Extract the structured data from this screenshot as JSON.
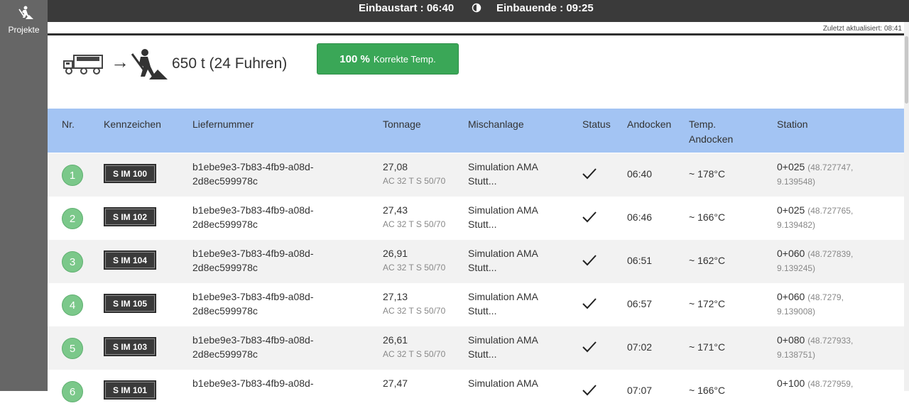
{
  "sidebar": {
    "items": [
      {
        "label": "Projekte",
        "icon": "road-worker-icon"
      }
    ]
  },
  "topbar": {
    "start": "Einbaustart : 06:40",
    "end": "Einbauende : 09:25"
  },
  "updated": "Zuletzt aktualisiert: 08:41",
  "summary": {
    "tonnage": "650 t (24 Fuhren)",
    "pct": "100 %",
    "label": "Korrekte Temp."
  },
  "colors": {
    "accent_green": "#3aa757",
    "header_blue": "#a3c4f3",
    "plate_bg": "#3a3a3a",
    "topbar_bg": "#3a3a3a",
    "sidebar_bg": "#666666"
  },
  "table": {
    "headers": [
      "Nr.",
      "Kennzeichen",
      "Liefernummer",
      "Tonnage",
      "Mischanlage",
      "Status",
      "Andocken",
      "Temp.",
      "Andocken",
      "Station"
    ],
    "rows": [
      {
        "nr": "1",
        "plate": "S IM 100",
        "lief1": "b1ebe9e3-7b83-4fb9-a08d-",
        "lief2": "2d8ec599978c",
        "ton": "27,08",
        "mix": "AC 32 T S 50/70",
        "plant1": "Simulation AMA",
        "plant2": "Stutt...",
        "dock": "06:40",
        "temp": "~ 178°C",
        "station": "0+025",
        "coord1": "(48.727747,",
        "coord2": "9.139548)"
      },
      {
        "nr": "2",
        "plate": "S IM 102",
        "lief1": "b1ebe9e3-7b83-4fb9-a08d-",
        "lief2": "2d8ec599978c",
        "ton": "27,43",
        "mix": "AC 32 T S 50/70",
        "plant1": "Simulation AMA",
        "plant2": "Stutt...",
        "dock": "06:46",
        "temp": "~ 166°C",
        "station": "0+025",
        "coord1": "(48.727765,",
        "coord2": "9.139482)"
      },
      {
        "nr": "3",
        "plate": "S IM 104",
        "lief1": "b1ebe9e3-7b83-4fb9-a08d-",
        "lief2": "2d8ec599978c",
        "ton": "26,91",
        "mix": "AC 32 T S 50/70",
        "plant1": "Simulation AMA",
        "plant2": "Stutt...",
        "dock": "06:51",
        "temp": "~ 162°C",
        "station": "0+060",
        "coord1": "(48.727839,",
        "coord2": "9.139245)"
      },
      {
        "nr": "4",
        "plate": "S IM 105",
        "lief1": "b1ebe9e3-7b83-4fb9-a08d-",
        "lief2": "2d8ec599978c",
        "ton": "27,13",
        "mix": "AC 32 T S 50/70",
        "plant1": "Simulation AMA",
        "plant2": "Stutt...",
        "dock": "06:57",
        "temp": "~ 172°C",
        "station": "0+060",
        "coord1": "(48.7279,",
        "coord2": "9.139008)"
      },
      {
        "nr": "5",
        "plate": "S IM 103",
        "lief1": "b1ebe9e3-7b83-4fb9-a08d-",
        "lief2": "2d8ec599978c",
        "ton": "26,61",
        "mix": "AC 32 T S 50/70",
        "plant1": "Simulation AMA",
        "plant2": "Stutt...",
        "dock": "07:02",
        "temp": "~ 171°C",
        "station": "0+080",
        "coord1": "(48.727933,",
        "coord2": "9.138751)"
      },
      {
        "nr": "6",
        "plate": "S IM 101",
        "lief1": "b1ebe9e3-7b83-4fb9-a08d-",
        "lief2": "",
        "ton": "27,47",
        "mix": "",
        "plant1": "Simulation AMA",
        "plant2": "",
        "dock": "07:07",
        "temp": "~ 166°C",
        "station": "0+100",
        "coord1": "(48.727959,",
        "coord2": ""
      }
    ]
  }
}
